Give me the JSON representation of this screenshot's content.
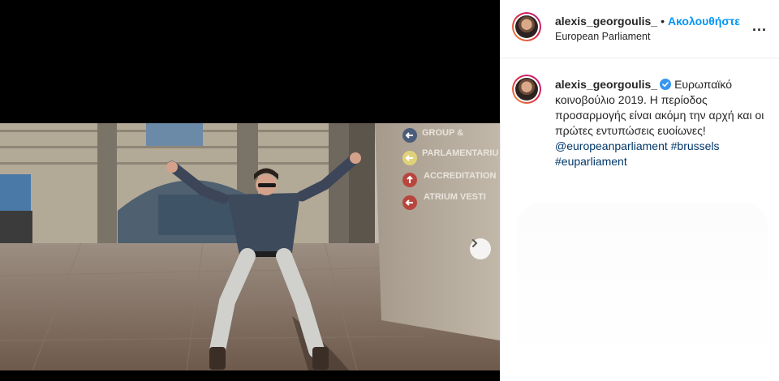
{
  "post": {
    "author": "alexis_georgoulis_",
    "follow_label": "Ακολουθήστε",
    "separator": "•",
    "location": "European Parliament",
    "more_label": "...",
    "caption": {
      "text": "Ευρωπαϊκό κοινοβούλιο 2019. Η περίοδος προσαρμογής είναι ακόμη την αρχή και οι πρώτες εντυπώσεις ευοίωνες!",
      "mention": "@europeanparliament",
      "hashtags": [
        "#brussels",
        "#euparliament"
      ]
    }
  },
  "photo_signs": [
    "GROUP & ...",
    "PARLAMENTARIU...",
    "ACCREDITATION",
    "ATRIUM VESTI..."
  ],
  "colors": {
    "link": "#00376b",
    "follow": "#0095f6",
    "verified": "#3897f0"
  }
}
